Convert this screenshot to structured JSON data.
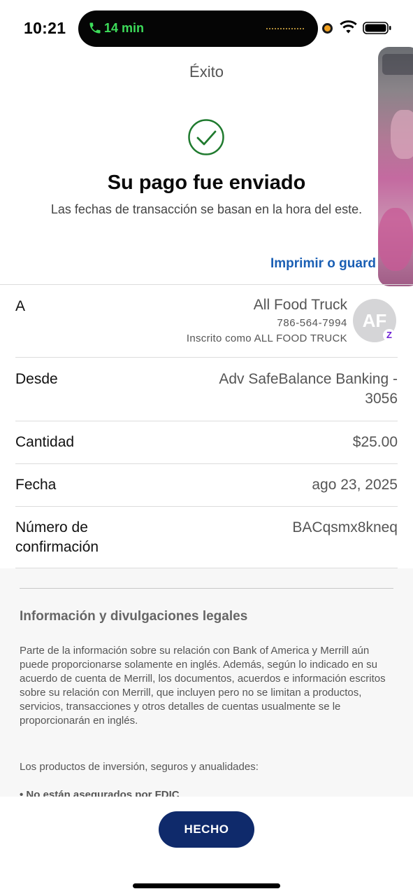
{
  "status_bar": {
    "time": "10:21",
    "call_timer": "14 min",
    "icons": [
      "phone-icon",
      "recording-dot-icon",
      "wifi-icon",
      "battery-icon"
    ],
    "call_color": "#3ddc5a"
  },
  "header": {
    "nav_title": "Éxito",
    "headline": "Su pago fue enviado",
    "subline": "Las fechas de transacción se basan en la hora del este.",
    "print_link": "Imprimir o guard",
    "success_color": "#1f7a2e",
    "link_color": "#1a5fb4"
  },
  "details": {
    "to": {
      "label": "A",
      "name": "All Food Truck",
      "phone": "786-564-7994",
      "enrolled": "Inscrito como ALL FOOD TRUCK",
      "avatar_initials": "AF",
      "badge": "Z"
    },
    "from": {
      "label": "Desde",
      "value_line1": "Adv SafeBalance Banking -",
      "value_line2": "3056"
    },
    "amount": {
      "label": "Cantidad",
      "value": "$25.00"
    },
    "date": {
      "label": "Fecha",
      "value": "ago 23, 2025"
    },
    "confirmation": {
      "label_line1": "Número de",
      "label_line2": "confirmación",
      "value": "BACqsmx8kneq"
    }
  },
  "legal": {
    "title": "Información y divulgaciones legales",
    "paragraph1": "Parte de la información sobre su relación con Bank of America y Merrill aún puede proporcionarse solamente en inglés. Además, según lo indicado en su acuerdo de cuenta de Merrill, los documentos, acuerdos e información escritos sobre su relación con Merrill, que incluyen pero no se limitan a productos, servicios, transacciones y otros detalles de cuentas usualmente se le proporcionarán en inglés.",
    "paragraph2": "Los productos de inversión, seguros y anualidades:",
    "bullet1": "• No están asegurados por FDIC"
  },
  "footer": {
    "done_label": "HECHO",
    "button_color": "#0f2a6b"
  }
}
